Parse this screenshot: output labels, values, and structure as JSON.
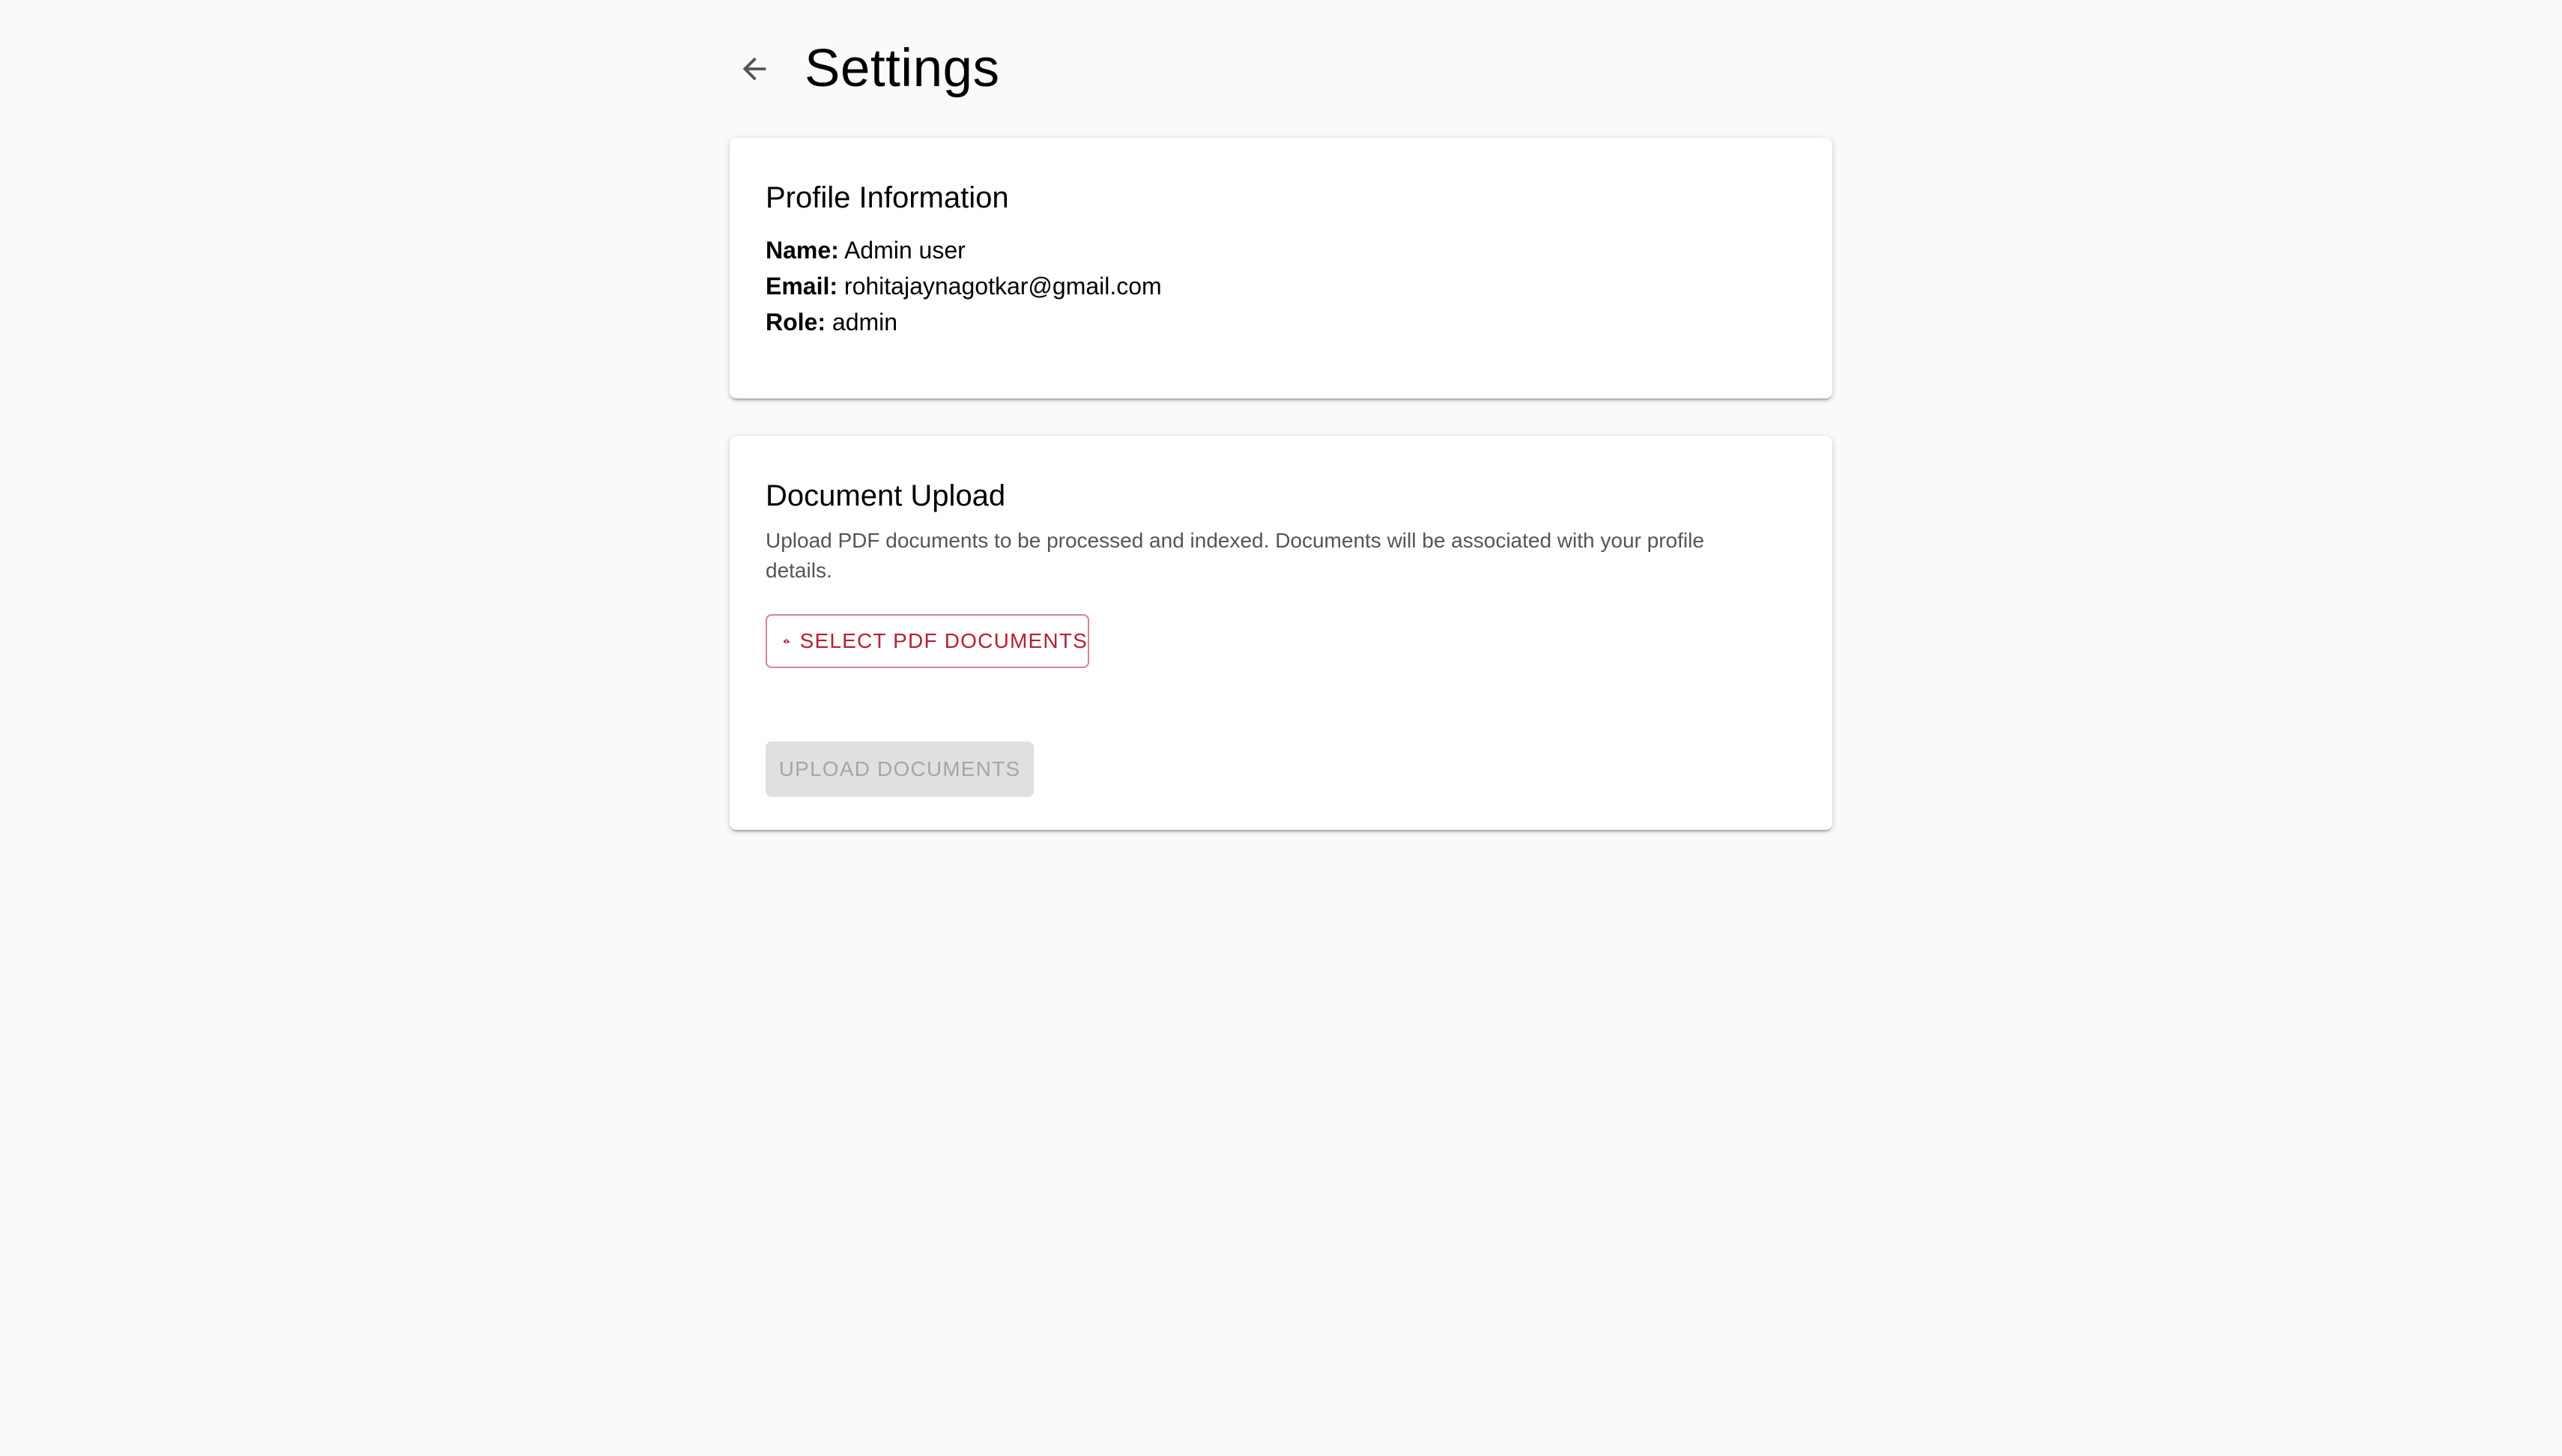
{
  "header": {
    "title": "Settings",
    "back_icon": "arrow-back-icon"
  },
  "profile": {
    "title": "Profile Information",
    "fields": [
      {
        "label": "Name:",
        "value": "Admin user"
      },
      {
        "label": "Email:",
        "value": "rohitajaynagotkar@gmail.com"
      },
      {
        "label": "Role:",
        "value": "admin"
      }
    ]
  },
  "upload": {
    "title": "Document Upload",
    "description": "Upload PDF documents to be processed and indexed. Documents will be associated with your profile details.",
    "select_button": {
      "label": "SELECT PDF DOCUMENTS",
      "icon": "cloud-upload-icon"
    },
    "upload_button": {
      "label": "UPLOAD DOCUMENTS",
      "disabled": true
    }
  },
  "colors": {
    "background": "#fafafa",
    "card": "#ffffff",
    "accent": "#b3203a",
    "disabled_bg": "#e0e0e0",
    "disabled_text": "#a6a6a6"
  }
}
